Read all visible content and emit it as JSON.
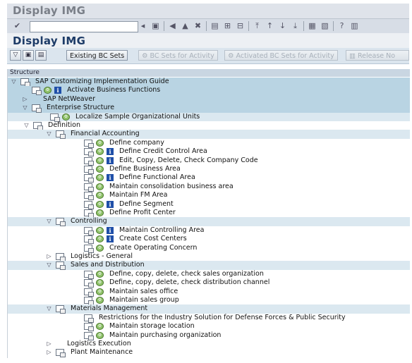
{
  "window": {
    "title": "Display IMG"
  },
  "system_toolbar": {
    "command_value": ""
  },
  "screen": {
    "title": "Display IMG"
  },
  "app_toolbar": {
    "existing_bc_sets": "Existing BC Sets",
    "bc_sets_for_activity": "BC Sets for Activity",
    "activated_bc_sets": "Activated BC Sets for Activity",
    "release_notes": "Release No"
  },
  "tree": {
    "header": "Structure",
    "rows": [
      {
        "label": "SAP Customizing Implementation Guide",
        "level": 0,
        "expander": "open",
        "doc": true,
        "exec": false,
        "info": false,
        "bg": "blue"
      },
      {
        "label": "Activate Business Functions",
        "level": 1,
        "expander": "none",
        "doc": true,
        "exec": true,
        "info": true,
        "bg": "blue"
      },
      {
        "label": "SAP NetWeaver",
        "level": 1,
        "expander": "closed",
        "doc": false,
        "exec": false,
        "info": false,
        "bg": "blue"
      },
      {
        "label": "Enterprise Structure",
        "level": 1,
        "expander": "open",
        "doc": true,
        "exec": false,
        "info": false,
        "bg": "blue"
      },
      {
        "label": "Localize Sample Organizational Units",
        "level": 2,
        "expander": "none",
        "doc": true,
        "exec": true,
        "info": false,
        "bg": "lblue"
      },
      {
        "label": "Definition",
        "level": 2,
        "expander": "open",
        "doc": true,
        "exec": false,
        "info": false,
        "bg": "none"
      },
      {
        "label": "Financial Accounting",
        "level": 3,
        "expander": "open",
        "doc": true,
        "exec": false,
        "info": false,
        "bg": "lblue"
      },
      {
        "label": "Define company",
        "level": 4,
        "expander": "none",
        "doc": true,
        "exec": true,
        "info": false,
        "bg": "none"
      },
      {
        "label": "Define Credit Control Area",
        "level": 4,
        "expander": "none",
        "doc": true,
        "exec": true,
        "info": true,
        "bg": "none"
      },
      {
        "label": "Edit, Copy, Delete, Check Company Code",
        "level": 4,
        "expander": "none",
        "doc": true,
        "exec": true,
        "info": true,
        "bg": "none"
      },
      {
        "label": "Define Business Area",
        "level": 4,
        "expander": "none",
        "doc": true,
        "exec": true,
        "info": false,
        "bg": "none"
      },
      {
        "label": "Define Functional Area",
        "level": 4,
        "expander": "none",
        "doc": true,
        "exec": true,
        "info": true,
        "bg": "none"
      },
      {
        "label": "Maintain consolidation business area",
        "level": 4,
        "expander": "none",
        "doc": true,
        "exec": true,
        "info": false,
        "bg": "none"
      },
      {
        "label": "Maintain FM Area",
        "level": 4,
        "expander": "none",
        "doc": true,
        "exec": true,
        "info": false,
        "bg": "none"
      },
      {
        "label": "Define Segment",
        "level": 4,
        "expander": "none",
        "doc": true,
        "exec": true,
        "info": true,
        "bg": "none"
      },
      {
        "label": "Define Profit Center",
        "level": 4,
        "expander": "none",
        "doc": true,
        "exec": true,
        "info": false,
        "bg": "none"
      },
      {
        "label": "Controlling",
        "level": 3,
        "expander": "open",
        "doc": true,
        "exec": false,
        "info": false,
        "bg": "lblue"
      },
      {
        "label": "Maintain Controlling Area",
        "level": 4,
        "expander": "none",
        "doc": true,
        "exec": true,
        "info": true,
        "bg": "none"
      },
      {
        "label": "Create Cost Centers",
        "level": 4,
        "expander": "none",
        "doc": true,
        "exec": true,
        "info": true,
        "bg": "none"
      },
      {
        "label": "Create Operating Concern",
        "level": 4,
        "expander": "none",
        "doc": true,
        "exec": true,
        "info": false,
        "bg": "none"
      },
      {
        "label": "Logistics - General",
        "level": 3,
        "expander": "closed",
        "doc": true,
        "exec": false,
        "info": false,
        "bg": "none"
      },
      {
        "label": "Sales and Distribution",
        "level": 3,
        "expander": "open",
        "doc": true,
        "exec": false,
        "info": false,
        "bg": "lblue"
      },
      {
        "label": "Define, copy, delete, check sales organization",
        "level": 4,
        "expander": "none",
        "doc": true,
        "exec": true,
        "info": false,
        "bg": "none"
      },
      {
        "label": "Define, copy, delete, check distribution channel",
        "level": 4,
        "expander": "none",
        "doc": true,
        "exec": true,
        "info": false,
        "bg": "none"
      },
      {
        "label": "Maintain sales office",
        "level": 4,
        "expander": "none",
        "doc": true,
        "exec": true,
        "info": false,
        "bg": "none"
      },
      {
        "label": "Maintain sales group",
        "level": 4,
        "expander": "none",
        "doc": true,
        "exec": true,
        "info": false,
        "bg": "none"
      },
      {
        "label": "Materials Management",
        "level": 3,
        "expander": "open",
        "doc": true,
        "exec": false,
        "info": false,
        "bg": "lblue"
      },
      {
        "label": "Restrictions for the Industry Solution for Defense Forces & Public Security",
        "level": 4,
        "expander": "none",
        "doc": true,
        "exec": false,
        "info": false,
        "bg": "none"
      },
      {
        "label": "Maintain storage location",
        "level": 4,
        "expander": "none",
        "doc": true,
        "exec": true,
        "info": false,
        "bg": "none"
      },
      {
        "label": "Maintain purchasing organization",
        "level": 4,
        "expander": "none",
        "doc": true,
        "exec": true,
        "info": false,
        "bg": "none"
      },
      {
        "label": "Logistics Execution",
        "level": 3,
        "expander": "closed",
        "doc": false,
        "exec": false,
        "info": false,
        "bg": "none"
      },
      {
        "label": "Plant Maintenance",
        "level": 3,
        "expander": "closed",
        "doc": true,
        "exec": false,
        "info": false,
        "bg": "none"
      }
    ]
  }
}
